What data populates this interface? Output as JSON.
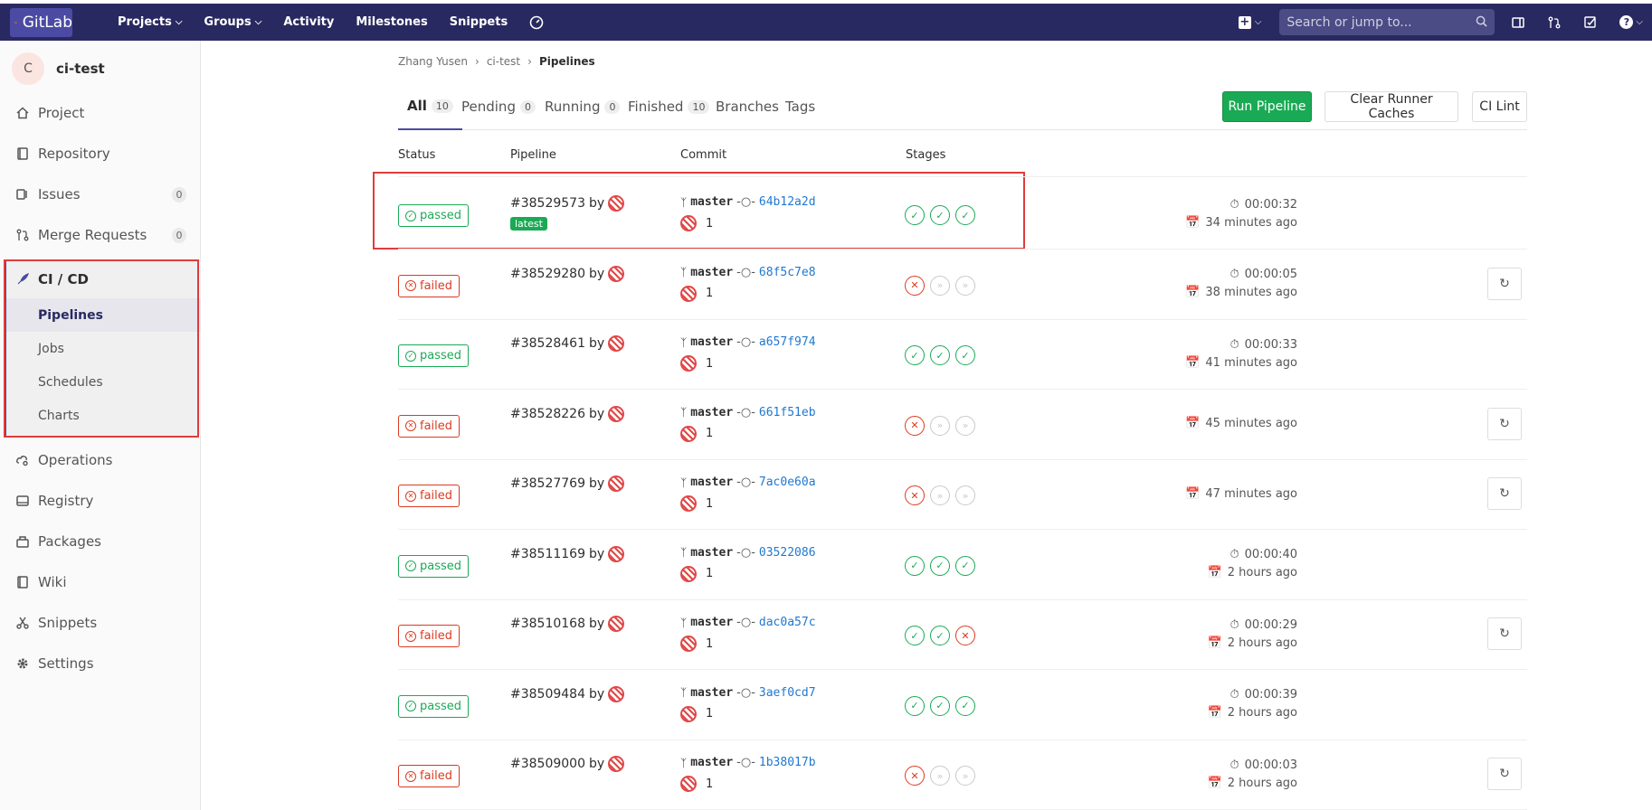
{
  "nav": {
    "logo": "GitLab",
    "items": [
      "Projects",
      "Groups",
      "Activity",
      "Milestones",
      "Snippets"
    ],
    "search_placeholder": "Search or jump to..."
  },
  "sidebar": {
    "avatar_letter": "C",
    "project_name": "ci-test",
    "items": [
      {
        "label": "Project",
        "icon": "home-icon"
      },
      {
        "label": "Repository",
        "icon": "book-icon"
      },
      {
        "label": "Issues",
        "icon": "issues-icon",
        "count": "0"
      },
      {
        "label": "Merge Requests",
        "icon": "merge-request-icon",
        "count": "0"
      },
      {
        "label": "CI / CD",
        "icon": "rocket-icon"
      },
      {
        "label": "Operations",
        "icon": "cloud-gear-icon"
      },
      {
        "label": "Registry",
        "icon": "disk-icon"
      },
      {
        "label": "Packages",
        "icon": "package-icon"
      },
      {
        "label": "Wiki",
        "icon": "book-icon"
      },
      {
        "label": "Snippets",
        "icon": "scissors-icon"
      },
      {
        "label": "Settings",
        "icon": "gear-icon"
      }
    ],
    "cicd_sub": [
      "Pipelines",
      "Jobs",
      "Schedules",
      "Charts"
    ]
  },
  "breadcrumb": [
    "Zhang Yusen",
    "ci-test",
    "Pipelines"
  ],
  "tabs": [
    {
      "label": "All",
      "count": "10"
    },
    {
      "label": "Pending",
      "count": "0"
    },
    {
      "label": "Running",
      "count": "0"
    },
    {
      "label": "Finished",
      "count": "10"
    },
    {
      "label": "Branches"
    },
    {
      "label": "Tags"
    }
  ],
  "buttons": {
    "run": "Run Pipeline",
    "clear": "Clear Runner Caches",
    "lint": "CI Lint"
  },
  "columns": [
    "Status",
    "Pipeline",
    "Commit",
    "Stages"
  ],
  "rows": [
    {
      "status": "passed",
      "id": "#38529573",
      "by": "by",
      "latest": "latest",
      "branch": "master",
      "sha": "64b12a2d",
      "num": "1",
      "stages": [
        "success",
        "success",
        "success"
      ],
      "duration": "00:00:32",
      "ago": "34 minutes ago",
      "retry": false
    },
    {
      "status": "failed",
      "id": "#38529280",
      "by": "by",
      "branch": "master",
      "sha": "68f5c7e8",
      "num": "1",
      "stages": [
        "failed",
        "skipped",
        "skipped"
      ],
      "duration": "00:00:05",
      "ago": "38 minutes ago",
      "retry": true
    },
    {
      "status": "passed",
      "id": "#38528461",
      "by": "by",
      "branch": "master",
      "sha": "a657f974",
      "num": "1",
      "stages": [
        "success",
        "success",
        "success"
      ],
      "duration": "00:00:33",
      "ago": "41 minutes ago",
      "retry": false
    },
    {
      "status": "failed",
      "id": "#38528226",
      "by": "by",
      "branch": "master",
      "sha": "661f51eb",
      "num": "1",
      "stages": [
        "failed",
        "skipped",
        "skipped"
      ],
      "duration": "",
      "ago": "45 minutes ago",
      "retry": true
    },
    {
      "status": "failed",
      "id": "#38527769",
      "by": "by",
      "branch": "master",
      "sha": "7ac0e60a",
      "num": "1",
      "stages": [
        "failed",
        "skipped",
        "skipped"
      ],
      "duration": "",
      "ago": "47 minutes ago",
      "retry": true
    },
    {
      "status": "passed",
      "id": "#38511169",
      "by": "by",
      "branch": "master",
      "sha": "03522086",
      "num": "1",
      "stages": [
        "success",
        "success",
        "success"
      ],
      "duration": "00:00:40",
      "ago": "2 hours ago",
      "retry": false
    },
    {
      "status": "failed",
      "id": "#38510168",
      "by": "by",
      "branch": "master",
      "sha": "dac0a57c",
      "num": "1",
      "stages": [
        "success",
        "success",
        "failed"
      ],
      "duration": "00:00:29",
      "ago": "2 hours ago",
      "retry": true
    },
    {
      "status": "passed",
      "id": "#38509484",
      "by": "by",
      "branch": "master",
      "sha": "3aef0cd7",
      "num": "1",
      "stages": [
        "success",
        "success",
        "success"
      ],
      "duration": "00:00:39",
      "ago": "2 hours ago",
      "retry": false
    },
    {
      "status": "failed",
      "id": "#38509000",
      "by": "by",
      "branch": "master",
      "sha": "1b38017b",
      "num": "1",
      "stages": [
        "failed",
        "skipped",
        "skipped"
      ],
      "duration": "00:00:03",
      "ago": "2 hours ago",
      "retry": true
    }
  ],
  "colors": {
    "navbar": "#292961",
    "passed": "#1aaa55",
    "failed": "#db3b21",
    "link": "#1f78d1",
    "highlight": "#e03c3c"
  }
}
